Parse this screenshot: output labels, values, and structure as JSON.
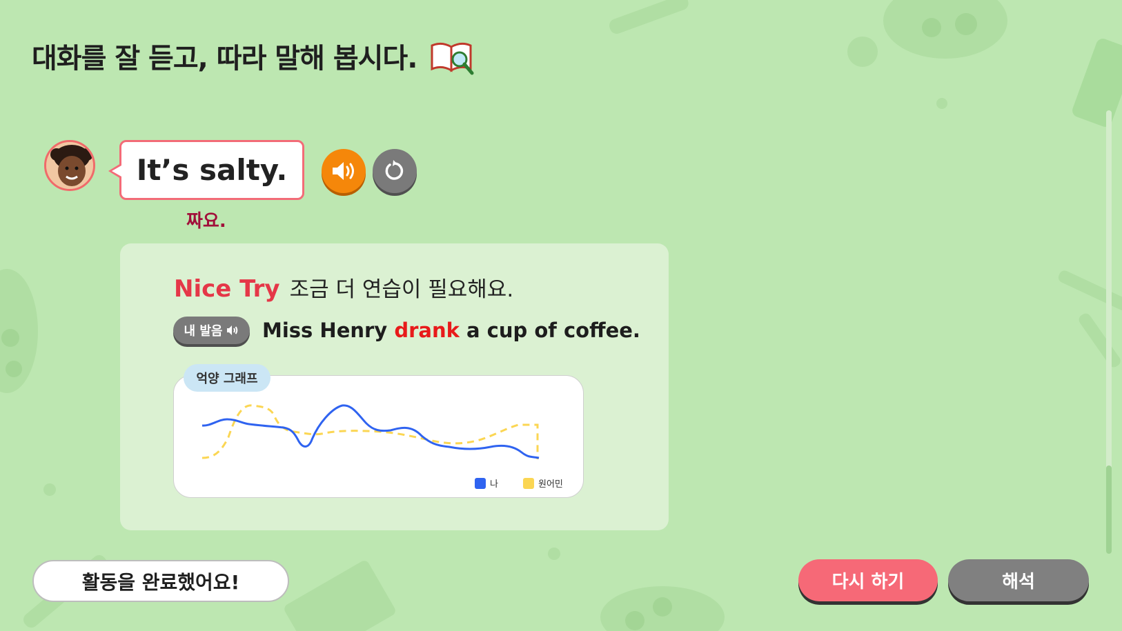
{
  "colors": {
    "background": "#bde7b1",
    "accent_red": "#e53748",
    "bubble_border": "#f36b77",
    "sound_button": "#f5870a",
    "retry_button": "#f66977",
    "interp_button": "#808080",
    "my_line": "#2f63f0",
    "native_line": "#fbd653"
  },
  "page": {
    "title": "대화를 잘 듣고, 따라 말해 봅시다.",
    "title_icon": "book-magnifier-icon"
  },
  "dialogue": {
    "speaker_avatar": "girl-avatar",
    "sentence": "It’s salty.",
    "translation": "짜요.",
    "sound_icon": "speaker-icon",
    "replay_icon": "replay-icon"
  },
  "result": {
    "grade": "Nice Try",
    "message": "조금 더 연습이 필요해요.",
    "my_pronunciation_label": "내 발음",
    "sentence_parts": [
      "Miss Henry ",
      "drank",
      " a cup of coffee."
    ],
    "wrong_word": "drank"
  },
  "graph": {
    "tag": "억양 그래프",
    "legend_me": "나",
    "legend_native": "원어민"
  },
  "buttons": {
    "done": "활동을 완료했어요!",
    "retry": "다시 하기",
    "interpretation": "해석"
  }
}
